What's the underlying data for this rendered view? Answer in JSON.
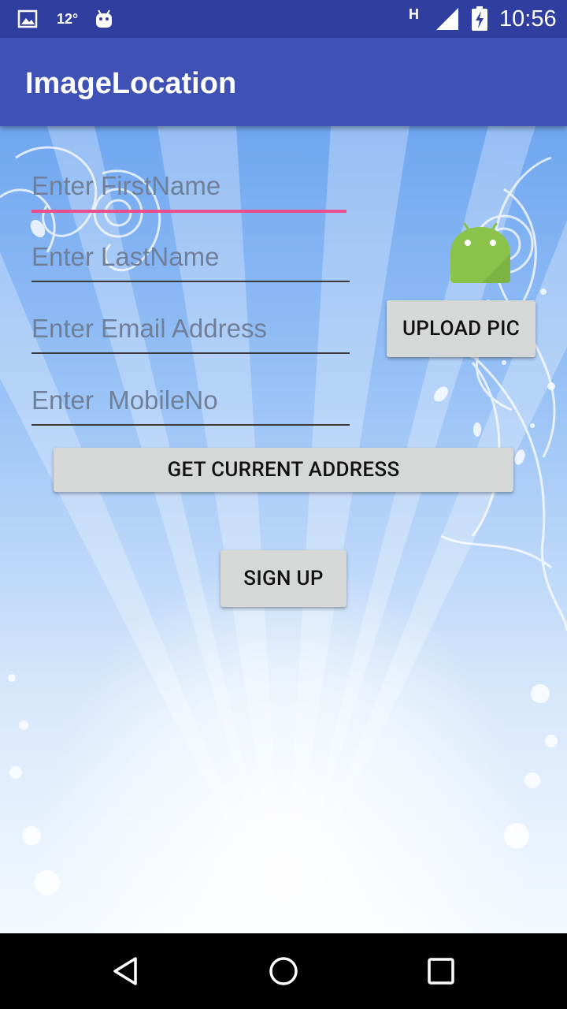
{
  "status_bar": {
    "temperature": "12°",
    "network_type": "H",
    "time": "10:56",
    "icons": [
      "image-icon",
      "android-notification-icon",
      "signal-icon",
      "battery-charging-icon"
    ]
  },
  "app_bar": {
    "title": "ImageLocation"
  },
  "form": {
    "first_name_placeholder": "Enter FirstName",
    "last_name_placeholder": "Enter LastName",
    "email_placeholder": "Enter Email Address",
    "mobile_placeholder": "Enter  MobileNo",
    "upload_pic_label": "UPLOAD PIC",
    "get_address_label": "GET CURRENT ADDRESS",
    "sign_up_label": "SIGN UP",
    "avatar_icon": "android-robot-icon"
  },
  "nav_bar": {
    "icons": [
      "back-icon",
      "home-icon",
      "recents-icon"
    ]
  },
  "colors": {
    "status_bar": "#303F9F",
    "app_bar": "#3F51B5",
    "focus_underline": "#E94F8C",
    "button_bg": "#D6D7D7",
    "android_green": "#8BC34A"
  }
}
